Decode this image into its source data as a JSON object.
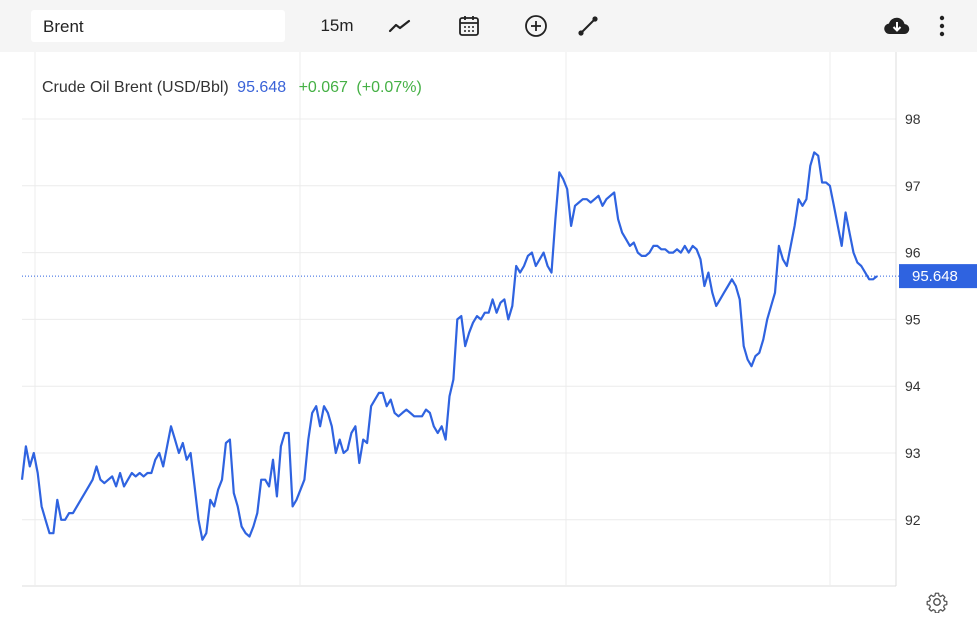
{
  "toolbar": {
    "symbol": "Brent",
    "interval": "15m",
    "icons": [
      "line-style-icon",
      "calendar-icon",
      "add-compare-icon",
      "draw-line-icon",
      "cloud-download-icon",
      "more-vertical-icon"
    ]
  },
  "legend": {
    "name": "Crude Oil Brent (USD/Bbl)",
    "value": "95.648",
    "change": "+0.067",
    "change_pct": "(+0.07%)"
  },
  "colors": {
    "line": "#2f63e0",
    "accent": "#2f63e0",
    "positive": "#45b045"
  },
  "chart_data": {
    "type": "line",
    "title": "Crude Oil Brent (USD/Bbl)",
    "xlabel": "",
    "ylabel": "",
    "ylim": [
      91.0,
      98.9
    ],
    "yticks": [
      "98",
      "97",
      "96",
      "95",
      "94",
      "93",
      "92"
    ],
    "current_price_label": "95.648",
    "current_price": 95.648,
    "grid": true,
    "series": [
      {
        "name": "",
        "values": [
          92.6,
          93.1,
          92.8,
          93.0,
          92.7,
          92.2,
          92.0,
          91.8,
          91.8,
          92.3,
          92.0,
          92.0,
          92.1,
          92.1,
          92.2,
          92.3,
          92.4,
          92.5,
          92.6,
          92.8,
          92.6,
          92.55,
          92.6,
          92.65,
          92.5,
          92.7,
          92.5,
          92.6,
          92.7,
          92.65,
          92.7,
          92.65,
          92.7,
          92.7,
          92.9,
          93.0,
          92.8,
          93.1,
          93.4,
          93.2,
          93.0,
          93.15,
          92.9,
          93.0,
          92.5,
          92.0,
          91.7,
          91.8,
          92.3,
          92.2,
          92.45,
          92.6,
          93.15,
          93.2,
          92.4,
          92.2,
          91.9,
          91.8,
          91.75,
          91.9,
          92.1,
          92.6,
          92.6,
          92.5,
          92.9,
          92.35,
          93.1,
          93.3,
          93.3,
          92.2,
          92.3,
          92.45,
          92.6,
          93.2,
          93.6,
          93.7,
          93.4,
          93.7,
          93.6,
          93.4,
          93.0,
          93.2,
          93.0,
          93.05,
          93.3,
          93.4,
          92.85,
          93.2,
          93.15,
          93.7,
          93.8,
          93.9,
          93.9,
          93.7,
          93.8,
          93.6,
          93.55,
          93.6,
          93.65,
          93.6,
          93.55,
          93.55,
          93.55,
          93.65,
          93.6,
          93.4,
          93.3,
          93.4,
          93.2,
          93.85,
          94.1,
          95.0,
          95.05,
          94.6,
          94.8,
          94.95,
          95.05,
          95.0,
          95.1,
          95.1,
          95.3,
          95.1,
          95.25,
          95.3,
          95.0,
          95.2,
          95.8,
          95.7,
          95.8,
          95.95,
          96.0,
          95.8,
          95.9,
          96.0,
          95.8,
          95.7,
          96.5,
          97.2,
          97.1,
          96.95,
          96.4,
          96.7,
          96.75,
          96.8,
          96.8,
          96.75,
          96.8,
          96.85,
          96.7,
          96.8,
          96.85,
          96.9,
          96.5,
          96.3,
          96.2,
          96.1,
          96.15,
          96.0,
          95.95,
          95.95,
          96.0,
          96.1,
          96.1,
          96.05,
          96.05,
          96.0,
          96.0,
          96.05,
          96.0,
          96.1,
          96.0,
          96.1,
          96.05,
          95.9,
          95.5,
          95.7,
          95.4,
          95.2,
          95.3,
          95.4,
          95.5,
          95.6,
          95.5,
          95.3,
          94.6,
          94.4,
          94.3,
          94.45,
          94.5,
          94.7,
          95.0,
          95.2,
          95.4,
          96.1,
          95.9,
          95.8,
          96.1,
          96.4,
          96.8,
          96.7,
          96.8,
          97.3,
          97.5,
          97.45,
          97.05,
          97.05,
          97.0,
          96.7,
          96.4,
          96.1,
          96.6,
          96.3,
          96.0,
          95.85,
          95.8,
          95.7,
          95.6,
          95.6,
          95.648
        ]
      }
    ]
  }
}
